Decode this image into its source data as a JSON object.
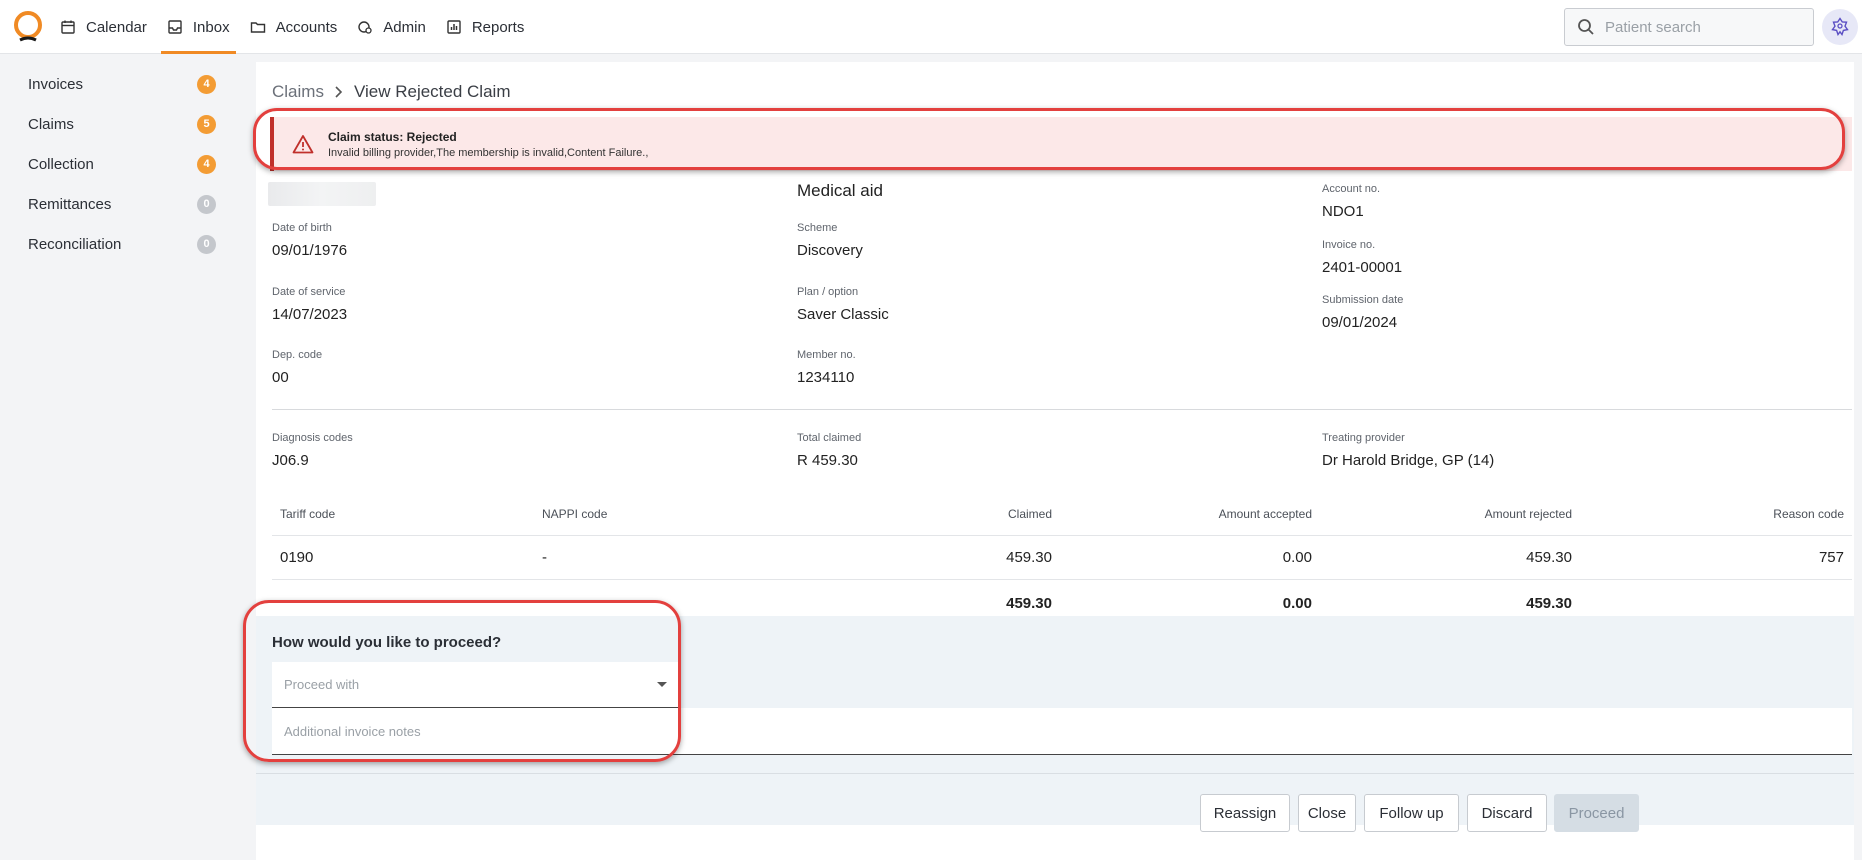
{
  "nav": {
    "items": [
      {
        "label": "Calendar",
        "icon": "calendar-icon"
      },
      {
        "label": "Inbox",
        "icon": "inbox-icon",
        "active": true
      },
      {
        "label": "Accounts",
        "icon": "folder-icon"
      },
      {
        "label": "Admin",
        "icon": "admin-gear-icon"
      },
      {
        "label": "Reports",
        "icon": "reports-icon"
      }
    ],
    "search_placeholder": "Patient search"
  },
  "sidebar": {
    "items": [
      {
        "label": "Invoices",
        "count": "4",
        "color": "#f39c34"
      },
      {
        "label": "Claims",
        "count": "5",
        "color": "#f39c34"
      },
      {
        "label": "Collection",
        "count": "4",
        "color": "#f39c34"
      },
      {
        "label": "Remittances",
        "count": "0",
        "color": "#c4c7cc"
      },
      {
        "label": "Reconciliation",
        "count": "0",
        "color": "#c4c7cc"
      }
    ]
  },
  "breadcrumb": {
    "parent": "Claims",
    "current": "View Rejected Claim"
  },
  "alert": {
    "title": "Claim status: Rejected",
    "message": "Invalid billing provider,The membership is invalid,Content Failure.,"
  },
  "patient": {
    "dob_label": "Date of birth",
    "dob": "09/01/1976",
    "dos_label": "Date of service",
    "dos": "14/07/2023",
    "dep_label": "Dep. code",
    "dep": "00"
  },
  "medical_aid": {
    "title": "Medical aid",
    "scheme_label": "Scheme",
    "scheme": "Discovery",
    "plan_label": "Plan / option",
    "plan": "Saver Classic",
    "member_label": "Member no.",
    "member": "1234110"
  },
  "account": {
    "account_label": "Account no.",
    "account": "NDO1",
    "invoice_label": "Invoice no.",
    "invoice": "2401-00001",
    "submission_label": "Submission date",
    "submission": "09/01/2024"
  },
  "summary": {
    "diagnosis_label": "Diagnosis codes",
    "diagnosis": "J06.9",
    "total_label": "Total claimed",
    "total": "R 459.30",
    "provider_label": "Treating provider",
    "provider": "Dr Harold Bridge, GP (14)"
  },
  "table": {
    "headers": [
      "Tariff code",
      "NAPPI code",
      "Claimed",
      "Amount accepted",
      "Amount rejected",
      "Reason code"
    ],
    "rows": [
      [
        "0190",
        "-",
        "459.30",
        "0.00",
        "459.30",
        "757"
      ]
    ],
    "totals": [
      "459.30",
      "0.00",
      "459.30"
    ]
  },
  "proceed": {
    "question": "How would you like to proceed?",
    "select_placeholder": "Proceed with",
    "notes_placeholder": "Additional invoice notes"
  },
  "actions": {
    "reassign": "Reassign",
    "close": "Close",
    "follow_up": "Follow up",
    "discard": "Discard",
    "proceed": "Proceed"
  },
  "colors": {
    "accent": "#f08a24",
    "alert_bg": "#fce8e8",
    "alert_border": "#c0302b",
    "highlight": "#e3403e"
  }
}
